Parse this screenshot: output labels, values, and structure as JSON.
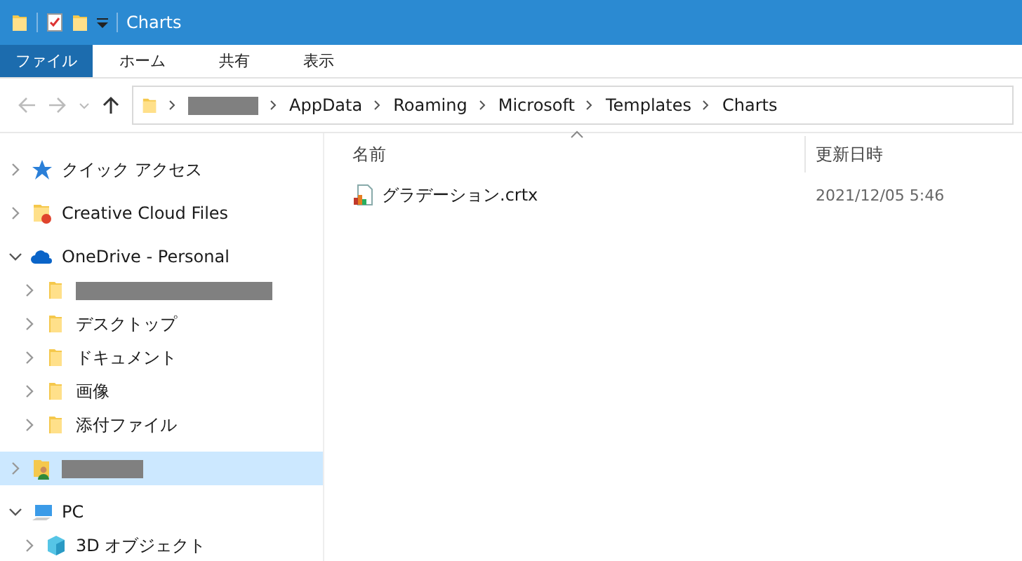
{
  "window": {
    "title": "Charts"
  },
  "ribbon_tabs": [
    {
      "label": "ファイル",
      "selected": true
    },
    {
      "label": "ホーム",
      "selected": false
    },
    {
      "label": "共有",
      "selected": false
    },
    {
      "label": "表示",
      "selected": false
    }
  ],
  "breadcrumbs": [
    {
      "redacted": true
    },
    {
      "label": "AppData",
      "redacted": false
    },
    {
      "label": "Roaming",
      "redacted": false
    },
    {
      "label": "Microsoft",
      "redacted": false
    },
    {
      "label": "Templates",
      "redacted": false
    },
    {
      "label": "Charts",
      "redacted": false
    }
  ],
  "nav_tree": [
    {
      "kind": "quick-access",
      "label": "クイック アクセス",
      "redacted": false,
      "expanded": false,
      "selected": false
    },
    {
      "kind": "cloud-files",
      "label": "Creative Cloud Files",
      "redacted": false,
      "expanded": false,
      "selected": false
    },
    {
      "kind": "onedrive",
      "label": "OneDrive - Personal",
      "redacted": false,
      "expanded": true,
      "selected": false,
      "children": [
        {
          "kind": "folder",
          "redacted": true,
          "expanded": false,
          "selected": false
        },
        {
          "kind": "folder",
          "label": "デスクトップ",
          "redacted": false,
          "expanded": false,
          "selected": false
        },
        {
          "kind": "folder",
          "label": "ドキュメント",
          "redacted": false,
          "expanded": false,
          "selected": false
        },
        {
          "kind": "folder",
          "label": "画像",
          "redacted": false,
          "expanded": false,
          "selected": false
        },
        {
          "kind": "folder",
          "label": "添付ファイル",
          "redacted": false,
          "expanded": false,
          "selected": false
        }
      ]
    },
    {
      "kind": "user",
      "redacted": true,
      "expanded": false,
      "selected": true
    },
    {
      "kind": "pc",
      "label": "PC",
      "redacted": false,
      "expanded": true,
      "selected": false,
      "children": [
        {
          "kind": "objects",
          "label": "3D オブジェクト",
          "redacted": false,
          "expanded": false,
          "selected": false
        }
      ]
    }
  ],
  "file_list": {
    "columns": [
      {
        "label": "名前",
        "sorted": true
      },
      {
        "label": "更新日時",
        "sorted": false
      }
    ],
    "rows": [
      {
        "name": "グラデーション.crtx",
        "modified": "2021/12/05 5:46"
      }
    ]
  }
}
